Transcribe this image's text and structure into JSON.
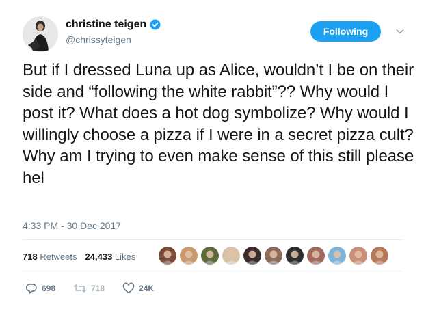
{
  "user": {
    "name": "christine teigen",
    "handle": "@chrissyteigen"
  },
  "follow_button": {
    "label": "Following"
  },
  "tweet": {
    "text": "But if I dressed Luna up as Alice, wouldn’t I be on their side and “following the white rabbit”?? Why would I post it? What does a hot dog symbolize? Why would I willingly choose a pizza if I were in a secret pizza cult? Why am I trying to even make sense of this still please hel",
    "timestamp": "4:33 PM - 30 Dec 2017"
  },
  "stats": {
    "retweets_count": "718",
    "retweets_label": "Retweets",
    "likes_count": "24,433",
    "likes_label": "Likes"
  },
  "liker_faces": [
    {
      "color": "#7a4a3a"
    },
    {
      "color": "#c99a72"
    },
    {
      "color": "#5b6b3a"
    },
    {
      "color": "#d9c3a8"
    },
    {
      "color": "#3a2c2a"
    },
    {
      "color": "#8e6a5a"
    },
    {
      "color": "#2d2d2d"
    },
    {
      "color": "#a06a5c"
    },
    {
      "color": "#7db4d6"
    },
    {
      "color": "#c98f78"
    },
    {
      "color": "#b57a5a"
    }
  ],
  "actions": {
    "replies": "698",
    "retweets": "718",
    "likes": "24K"
  },
  "colors": {
    "accent": "#1da1f2",
    "text": "#14171a",
    "muted": "#657786"
  },
  "icons": {
    "verified": "verified-badge-icon",
    "caret": "chevron-down-icon",
    "reply": "reply-icon",
    "retweet": "retweet-icon",
    "like": "heart-icon"
  }
}
